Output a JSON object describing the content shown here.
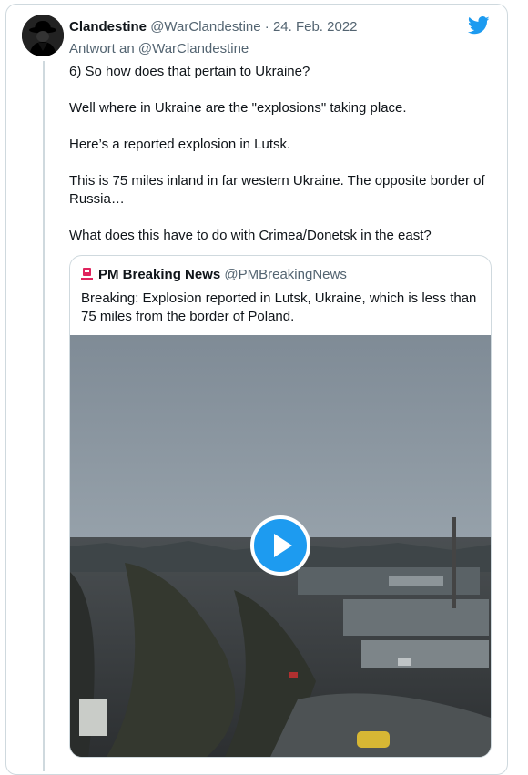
{
  "tweet": {
    "author_name": "Clandestine",
    "author_handle": "@WarClandestine",
    "date": "24. Feb. 2022",
    "reply_to_prefix": "Antwort an",
    "reply_to_handle": "@WarClandestine",
    "paragraphs": [
      "6) So how does that pertain to Ukraine?",
      "Well where in Ukraine are the \"explosions\" taking place.",
      "Here’s a reported explosion in Lutsk.",
      "This is 75 miles inland in far western Ukraine. The opposite border of Russia…",
      "What does this have to do with Crimea/Donetsk in the east?"
    ]
  },
  "quote": {
    "author_name": "PM Breaking News",
    "author_handle": "@PMBreakingNews",
    "text": "Breaking: Explosion reported in Lutsk, Ukraine, which is less than 75 miles from the border of Poland."
  },
  "icons": {
    "brand": "twitter-bird-icon",
    "media": "play-icon",
    "brand_color": "#1d9bf0"
  }
}
